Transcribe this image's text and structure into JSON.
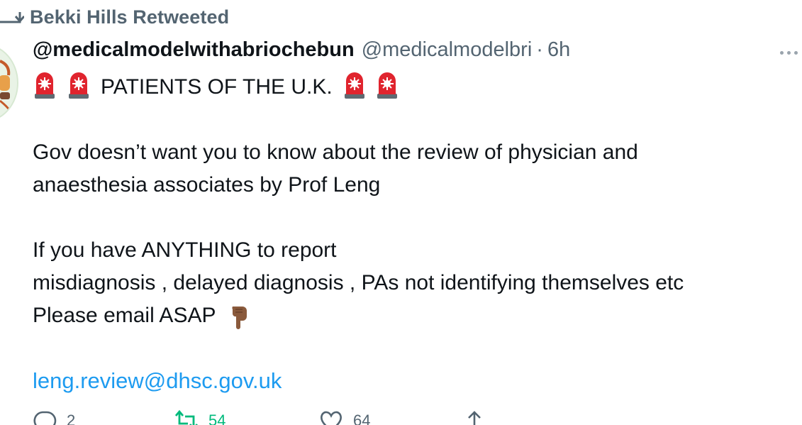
{
  "context": {
    "text": "Bekki Hills Retweeted",
    "icon": "retweet-icon"
  },
  "author": {
    "display_name": "@medicalmodelwithabriochebun",
    "handle": "@medicalmodelbri",
    "separator": "·",
    "time": "6h"
  },
  "tweet": {
    "headline": "PATIENTS OF THE U.K.",
    "line2": "Gov doesn’t want you to know about the review of physician and",
    "line3": "anaesthesia associates by Prof Leng",
    "line4": "If you have ANYTHING to report",
    "line5": "misdiagnosis , delayed diagnosis , PAs not identifying themselves etc",
    "line6": "Please email ASAP",
    "link": "leng.review@dhsc.gov.uk"
  },
  "actions": {
    "reply_count": "2",
    "retweet_count": "54",
    "like_count": "64"
  },
  "colors": {
    "text": "#0f1419",
    "secondary": "#536471",
    "link": "#1d9bf0",
    "retweet_active": "#00ba7c"
  }
}
